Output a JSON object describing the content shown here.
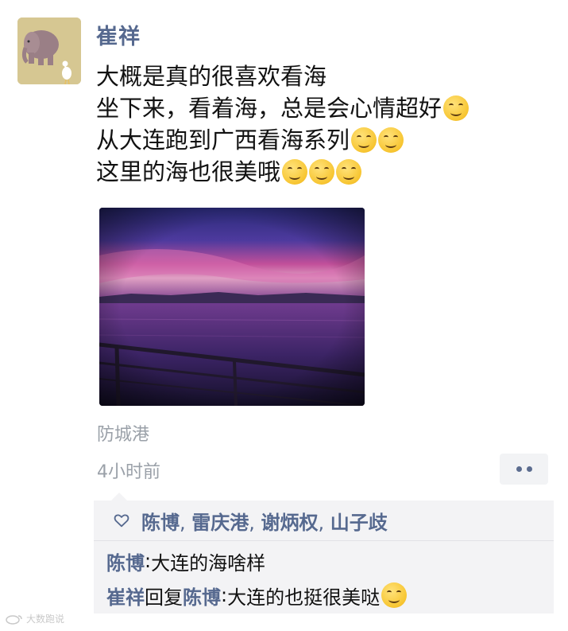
{
  "post": {
    "author": "崔祥",
    "lines": [
      {
        "text": "大概是真的很喜欢看海",
        "emoji_count": 0
      },
      {
        "text": "坐下来，看着海，总是会心情超好",
        "emoji_count": 1
      },
      {
        "text": "从大连跑到广西看海系列",
        "emoji_count": 2
      },
      {
        "text": "这里的海也很美哦",
        "emoji_count": 3
      }
    ],
    "emojis": [
      "ok-emoji",
      "grin-emoji",
      "grin-emoji",
      "hug-emoji",
      "hug-emoji",
      "hug-emoji"
    ],
    "location": "防城港",
    "timestamp": "4小时前"
  },
  "likes": {
    "names": [
      "陈博",
      "雷庆港",
      "谢炳权",
      "山子歧"
    ],
    "separator": ", "
  },
  "comments": [
    {
      "name": "陈博",
      "reply_word": "",
      "reply_to": "",
      "colon": ": ",
      "text": "大连的海啥样",
      "emoji": false
    },
    {
      "name": "崔祥",
      "reply_word": "回复",
      "reply_to": "陈博",
      "colon": ": ",
      "text": "大连的也挺很美哒",
      "emoji": true
    }
  ],
  "watermark": "大数跑说",
  "colors": {
    "name_blue": "#56698f",
    "panel_bg": "#f3f3f5",
    "meta_gray": "#9aa0a8"
  }
}
